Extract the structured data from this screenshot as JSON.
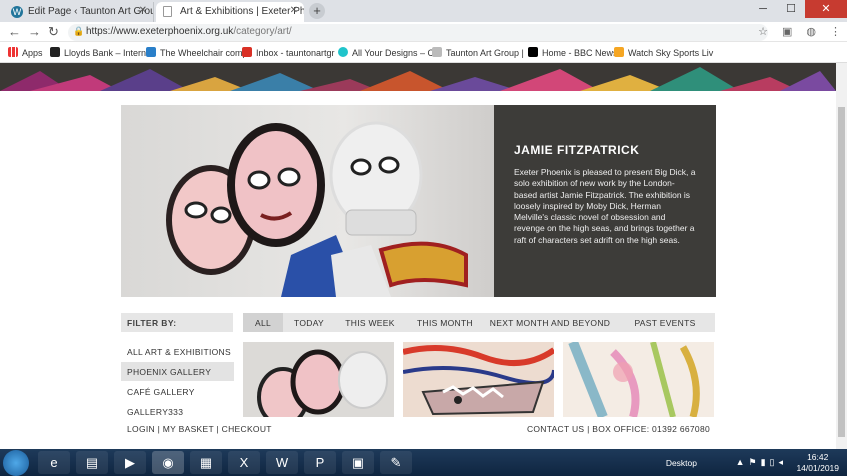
{
  "browser": {
    "tabs": [
      {
        "title": "Edit Page ‹ Taunton Art Group — ",
        "active": false,
        "favicon": "wordpress-icon"
      },
      {
        "title": "Art & Exhibitions | Exeter Phoenix",
        "active": true,
        "favicon": "page-icon"
      }
    ],
    "url_host": "https://www.exeterphoenix.org.uk",
    "url_path": "/category/art/",
    "bookmarks": [
      {
        "label": "Apps",
        "icon": "apps-icon"
      },
      {
        "label": "Lloyds Bank – Internet",
        "icon": "horse-icon"
      },
      {
        "label": "The Wheelchair comp",
        "icon": "wheelchair-icon"
      },
      {
        "label": "Inbox - tauntonartgr",
        "icon": "gmail-icon"
      },
      {
        "label": "All Your Designs – Ca",
        "icon": "canva-icon"
      },
      {
        "label": "Taunton Art Group |",
        "icon": "tag-icon"
      },
      {
        "label": "Home - BBC News",
        "icon": "bbc-icon"
      },
      {
        "label": "Watch Sky Sports Liv",
        "icon": "sky-icon"
      }
    ]
  },
  "hero": {
    "title": "JAMIE FITZPATRICK",
    "description": "Exeter Phoenix is pleased to present Big Dick, a solo exhibition of new work by the London-based artist Jamie Fitzpatrick. The exhibition is loosely inspired by Moby Dick, Herman Melville's classic novel of obsession and revenge on the high seas, and brings together a raft of characters set adrift on the high seas."
  },
  "filter": {
    "label": "FILTER BY:",
    "tabs": [
      "ALL",
      "TODAY",
      "THIS WEEK",
      "THIS MONTH",
      "NEXT MONTH AND BEYOND",
      "PAST EVENTS"
    ],
    "selected": "ALL"
  },
  "categories": [
    {
      "label": "ALL ART & EXHIBITIONS",
      "selected": false
    },
    {
      "label": "PHOENIX GALLERY",
      "selected": true
    },
    {
      "label": "CAFÉ GALLERY",
      "selected": false
    },
    {
      "label": "GALLERY333",
      "selected": false
    }
  ],
  "footer": {
    "left": "LOGIN | MY BASKET | CHECKOUT",
    "right": "CONTACT US | BOX OFFICE: 01392 667080"
  },
  "taskbar": {
    "desktop_label": "Desktop",
    "time": "16:42",
    "date": "14/01/2019"
  },
  "colors": {
    "panel_dark": "#3d3c39",
    "filter_bg": "#e6e6e6"
  }
}
